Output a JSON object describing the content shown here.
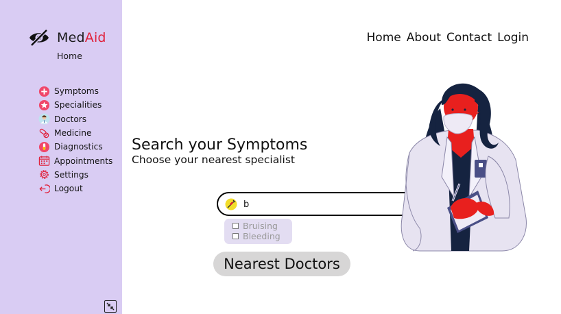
{
  "brand": {
    "name_part1": "Med",
    "name_part2": "Aid",
    "icon": "eye-slash-icon",
    "accent_color": "#e0203a"
  },
  "sidebar": {
    "background": "#d9ccf3",
    "home_label": "Home",
    "items": [
      {
        "label": "Symptoms",
        "icon": "plus-circle-icon"
      },
      {
        "label": "Specialities",
        "icon": "star-badge-icon"
      },
      {
        "label": "Doctors",
        "icon": "doctor-avatar-icon"
      },
      {
        "label": "Medicine",
        "icon": "pills-icon"
      },
      {
        "label": "Diagnostics",
        "icon": "test-tube-icon"
      },
      {
        "label": "Appointments",
        "icon": "calendar-icon"
      },
      {
        "label": "Settings",
        "icon": "gear-icon"
      },
      {
        "label": "Logout",
        "icon": "logout-icon"
      }
    ],
    "collapse_icon": "collapse-arrows-icon"
  },
  "topnav": {
    "home": "Home",
    "about": "About",
    "contact": "Contact",
    "login": "Login"
  },
  "main": {
    "headline": "Search your Symptoms",
    "subline": "Choose your nearest specialist",
    "search": {
      "value": "b",
      "left_icon": "syringe-icon",
      "button_icon": "search-icon"
    },
    "suggestions": [
      {
        "label": "Bruising"
      },
      {
        "label": "Bleeding"
      }
    ],
    "nearest_button": "Nearest Doctors"
  },
  "illustration": "doctor-illustration"
}
